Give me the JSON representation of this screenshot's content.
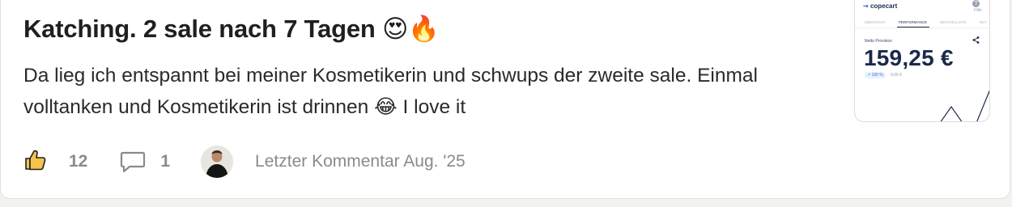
{
  "post": {
    "title": "Katching. 2 sale nach 7 Tagen",
    "title_emojis": "😍🔥",
    "body_line1": "Da lieg ich entspannt bei meiner Kosmetikerin und schwups der zweite sale. Einmal",
    "body_line2": "volltanken und Kosmetikerin ist drinnen",
    "body_emoji": "😂",
    "body_tail": "I love it"
  },
  "stats": {
    "likes": "12",
    "comments": "1",
    "last_comment": "Letzter Kommentar Aug. '25"
  },
  "thumbnail": {
    "logo": "copecart",
    "help_label": "Hilfe",
    "tabs": [
      "ÜBERSICHT",
      "PERFORMANCE",
      "BESTSELLISTE",
      "RET"
    ],
    "active_tab": "PERFORMANCE",
    "revenue_label": "Netto Provision",
    "amount": "159,25 €",
    "percent": "↗ 100 %",
    "small_amount": "0,00 €"
  },
  "colors": {
    "accent": "#1b2a4a",
    "like_icon": "#e8a317",
    "text_muted": "#8a8a8a"
  },
  "icons": [
    "thumbs-up-icon",
    "comment-icon",
    "share-icon",
    "help-icon"
  ]
}
